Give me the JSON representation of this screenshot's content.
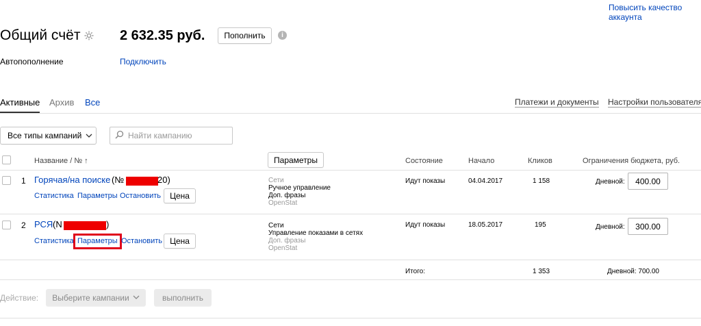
{
  "header": {
    "title": "Общий счёт",
    "balance": "2 632.35 руб.",
    "topup_label": "Пополнить",
    "improve_link_line1": "Повысить качество",
    "improve_link_line2": "аккаунта",
    "autopay_label": "Автопополнение",
    "autopay_link": "Подключить"
  },
  "tabs": [
    {
      "label": "Активные",
      "active": true
    },
    {
      "label": "Архив",
      "active": false
    },
    {
      "label": "Все",
      "active": false
    }
  ],
  "right_links": {
    "payments": "Платежи и документы",
    "settings": "Настройки пользователя"
  },
  "filters": {
    "types_label": "Все типы кампаний",
    "search_placeholder": "Найти кампанию"
  },
  "table": {
    "columns": {
      "name": "Название / № ↑",
      "params_button": "Параметры",
      "state": "Состояние",
      "start": "Начало",
      "clicks": "Кликов",
      "budget": "Ограничения бюджета, руб."
    },
    "rows": [
      {
        "num": "1",
        "name": "Горячая/на поиске",
        "id_prefix": "(№",
        "id_suffix": "20)",
        "params": [
          "Сети",
          "Ручное управление",
          "Доп. фразы",
          "OpenStat"
        ],
        "params_grey": [
          true,
          false,
          false,
          true
        ],
        "state": "Идут показы",
        "start": "04.04.2017",
        "clicks": "1 158",
        "budget_label": "Дневной:",
        "budget_value": "400.00",
        "actions": {
          "stats": "Статистика",
          "params": "Параметры",
          "stop": "Остановить",
          "price": "Цена"
        }
      },
      {
        "num": "2",
        "name": "РСЯ",
        "id_prefix": "(N",
        "id_suffix": ")",
        "params": [
          "Сети",
          "Управление показами в сетях",
          "Доп. фразы",
          "OpenStat"
        ],
        "params_grey": [
          false,
          false,
          true,
          true
        ],
        "state": "Идут показы",
        "start": "18.05.2017",
        "clicks": "195",
        "budget_label": "Дневной:",
        "budget_value": "300.00",
        "actions": {
          "stats": "Статистика",
          "params": "Параметры",
          "stop": "Остановить",
          "price": "Цена"
        }
      }
    ],
    "total": {
      "label": "Итого:",
      "clicks": "1 353",
      "budget": "Дневной: 700.00"
    }
  },
  "footer": {
    "action_label": "Действие:",
    "select_label": "Выберите кампании",
    "execute_label": "выполнить"
  },
  "colors": {
    "link": "#0044bb",
    "highlight": "#e0001a",
    "redaction": "#ee0000"
  }
}
